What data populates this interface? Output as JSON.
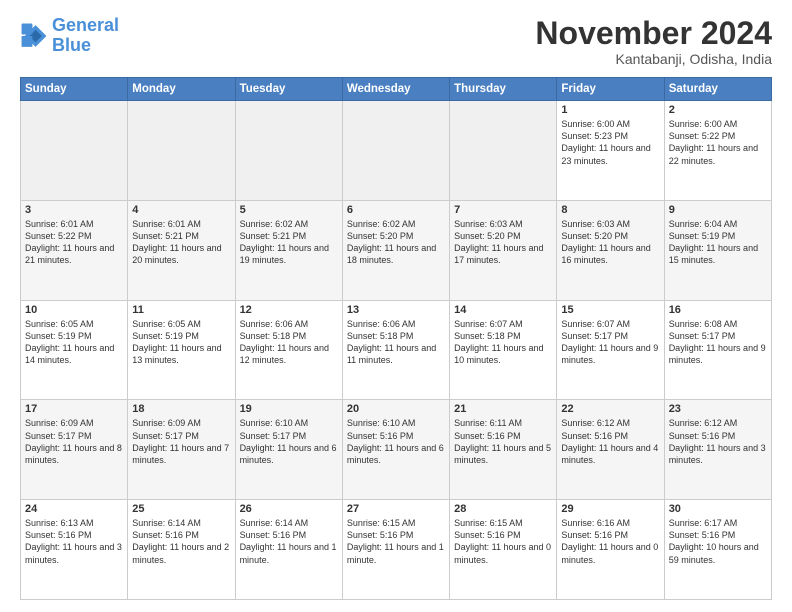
{
  "logo": {
    "line1": "General",
    "line2": "Blue"
  },
  "title": "November 2024",
  "subtitle": "Kantabanji, Odisha, India",
  "days_of_week": [
    "Sunday",
    "Monday",
    "Tuesday",
    "Wednesday",
    "Thursday",
    "Friday",
    "Saturday"
  ],
  "weeks": [
    [
      {
        "day": "",
        "text": ""
      },
      {
        "day": "",
        "text": ""
      },
      {
        "day": "",
        "text": ""
      },
      {
        "day": "",
        "text": ""
      },
      {
        "day": "",
        "text": ""
      },
      {
        "day": "1",
        "text": "Sunrise: 6:00 AM\nSunset: 5:23 PM\nDaylight: 11 hours and 23 minutes."
      },
      {
        "day": "2",
        "text": "Sunrise: 6:00 AM\nSunset: 5:22 PM\nDaylight: 11 hours and 22 minutes."
      }
    ],
    [
      {
        "day": "3",
        "text": "Sunrise: 6:01 AM\nSunset: 5:22 PM\nDaylight: 11 hours and 21 minutes."
      },
      {
        "day": "4",
        "text": "Sunrise: 6:01 AM\nSunset: 5:21 PM\nDaylight: 11 hours and 20 minutes."
      },
      {
        "day": "5",
        "text": "Sunrise: 6:02 AM\nSunset: 5:21 PM\nDaylight: 11 hours and 19 minutes."
      },
      {
        "day": "6",
        "text": "Sunrise: 6:02 AM\nSunset: 5:20 PM\nDaylight: 11 hours and 18 minutes."
      },
      {
        "day": "7",
        "text": "Sunrise: 6:03 AM\nSunset: 5:20 PM\nDaylight: 11 hours and 17 minutes."
      },
      {
        "day": "8",
        "text": "Sunrise: 6:03 AM\nSunset: 5:20 PM\nDaylight: 11 hours and 16 minutes."
      },
      {
        "day": "9",
        "text": "Sunrise: 6:04 AM\nSunset: 5:19 PM\nDaylight: 11 hours and 15 minutes."
      }
    ],
    [
      {
        "day": "10",
        "text": "Sunrise: 6:05 AM\nSunset: 5:19 PM\nDaylight: 11 hours and 14 minutes."
      },
      {
        "day": "11",
        "text": "Sunrise: 6:05 AM\nSunset: 5:19 PM\nDaylight: 11 hours and 13 minutes."
      },
      {
        "day": "12",
        "text": "Sunrise: 6:06 AM\nSunset: 5:18 PM\nDaylight: 11 hours and 12 minutes."
      },
      {
        "day": "13",
        "text": "Sunrise: 6:06 AM\nSunset: 5:18 PM\nDaylight: 11 hours and 11 minutes."
      },
      {
        "day": "14",
        "text": "Sunrise: 6:07 AM\nSunset: 5:18 PM\nDaylight: 11 hours and 10 minutes."
      },
      {
        "day": "15",
        "text": "Sunrise: 6:07 AM\nSunset: 5:17 PM\nDaylight: 11 hours and 9 minutes."
      },
      {
        "day": "16",
        "text": "Sunrise: 6:08 AM\nSunset: 5:17 PM\nDaylight: 11 hours and 9 minutes."
      }
    ],
    [
      {
        "day": "17",
        "text": "Sunrise: 6:09 AM\nSunset: 5:17 PM\nDaylight: 11 hours and 8 minutes."
      },
      {
        "day": "18",
        "text": "Sunrise: 6:09 AM\nSunset: 5:17 PM\nDaylight: 11 hours and 7 minutes."
      },
      {
        "day": "19",
        "text": "Sunrise: 6:10 AM\nSunset: 5:17 PM\nDaylight: 11 hours and 6 minutes."
      },
      {
        "day": "20",
        "text": "Sunrise: 6:10 AM\nSunset: 5:16 PM\nDaylight: 11 hours and 6 minutes."
      },
      {
        "day": "21",
        "text": "Sunrise: 6:11 AM\nSunset: 5:16 PM\nDaylight: 11 hours and 5 minutes."
      },
      {
        "day": "22",
        "text": "Sunrise: 6:12 AM\nSunset: 5:16 PM\nDaylight: 11 hours and 4 minutes."
      },
      {
        "day": "23",
        "text": "Sunrise: 6:12 AM\nSunset: 5:16 PM\nDaylight: 11 hours and 3 minutes."
      }
    ],
    [
      {
        "day": "24",
        "text": "Sunrise: 6:13 AM\nSunset: 5:16 PM\nDaylight: 11 hours and 3 minutes."
      },
      {
        "day": "25",
        "text": "Sunrise: 6:14 AM\nSunset: 5:16 PM\nDaylight: 11 hours and 2 minutes."
      },
      {
        "day": "26",
        "text": "Sunrise: 6:14 AM\nSunset: 5:16 PM\nDaylight: 11 hours and 1 minute."
      },
      {
        "day": "27",
        "text": "Sunrise: 6:15 AM\nSunset: 5:16 PM\nDaylight: 11 hours and 1 minute."
      },
      {
        "day": "28",
        "text": "Sunrise: 6:15 AM\nSunset: 5:16 PM\nDaylight: 11 hours and 0 minutes."
      },
      {
        "day": "29",
        "text": "Sunrise: 6:16 AM\nSunset: 5:16 PM\nDaylight: 11 hours and 0 minutes."
      },
      {
        "day": "30",
        "text": "Sunrise: 6:17 AM\nSunset: 5:16 PM\nDaylight: 10 hours and 59 minutes."
      }
    ]
  ]
}
